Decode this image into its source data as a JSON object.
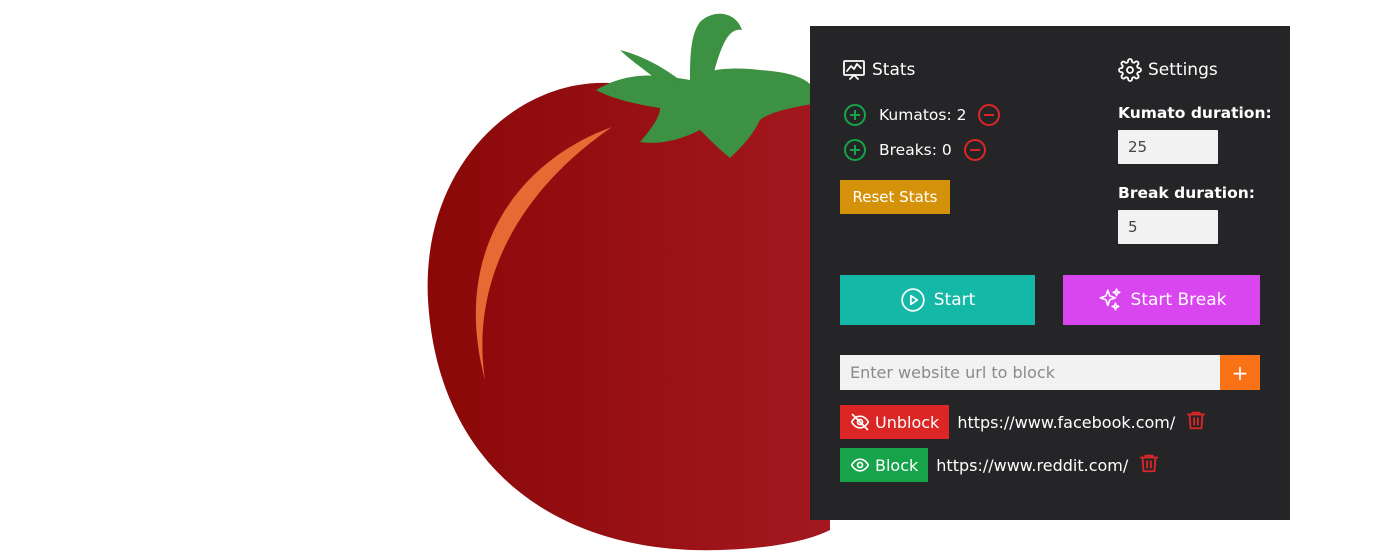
{
  "stats": {
    "title": "Stats",
    "kumatos_label": "Kumatos: 2",
    "breaks_label": "Breaks: 0",
    "reset_label": "Reset Stats"
  },
  "settings": {
    "title": "Settings",
    "kumato_duration_label": "Kumato duration:",
    "kumato_duration_value": "25",
    "break_duration_label": "Break duration:",
    "break_duration_value": "5"
  },
  "controls": {
    "start_label": "Start",
    "start_break_label": "Start Break"
  },
  "blocklist": {
    "placeholder": "Enter website url to block",
    "add_label": "+",
    "items": [
      {
        "action_label": "Unblock",
        "url": "https://www.facebook.com/"
      },
      {
        "action_label": "Block",
        "url": "https://www.reddit.com/"
      }
    ]
  },
  "colors": {
    "panel_bg": "#252528",
    "accent_teal": "#14b8a6",
    "accent_magenta": "#d946ef",
    "accent_orange": "#f97316",
    "reset_gold": "#d4920b",
    "unblock_red": "#dc2626",
    "block_green": "#16a34a",
    "tomato_red": "#a0151b",
    "leaf_green": "#3d9142"
  },
  "icons": [
    "tomato-illustration",
    "chart-icon",
    "gear-icon",
    "plus-circle-icon",
    "minus-circle-icon",
    "play-circle-icon",
    "sparkles-icon",
    "eye-off-icon",
    "eye-icon",
    "trash-icon"
  ]
}
